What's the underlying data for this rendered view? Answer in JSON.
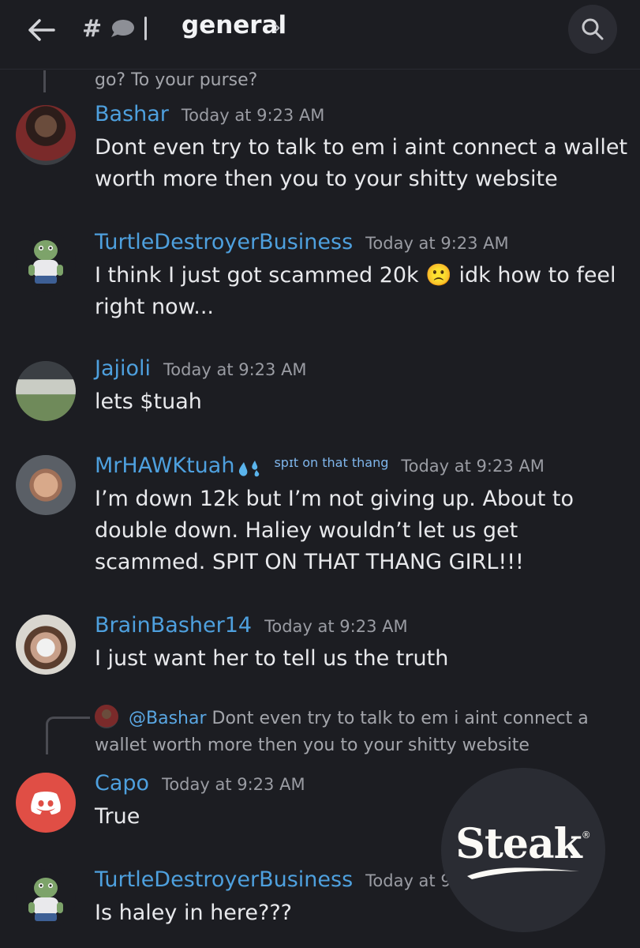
{
  "header": {
    "channel_name": "general",
    "hash_glyph": "#",
    "chevron": "›"
  },
  "previous": {
    "text": "go? To your purse?"
  },
  "messages": [
    {
      "username": "Bashar",
      "timestamp": "Today at 9:23 AM",
      "text": "Dont even try to talk to em i aint connect a wallet worth more then you to your shitty website",
      "avatar": "photo-avatar"
    },
    {
      "username": "TurtleDestroyerBusiness",
      "timestamp": "Today at 9:23 AM",
      "text_before_emoji": "I think I just got scammed 20k ",
      "emoji": "🙁",
      "text_after_emoji": " idk how to feel right now...",
      "avatar": "turtle-avatar"
    },
    {
      "username": "Jajioli",
      "timestamp": "Today at 9:23 AM",
      "text": "lets $tuah",
      "avatar": "landscape-avatar"
    },
    {
      "username": "MrHAWKtuah",
      "role_tag": "spɪt on that thang",
      "timestamp": "Today at 9:23 AM",
      "text": "I’m down 12k but I’m not giving up. About to double down. Haliey wouldn’t let us get scammed. SPIT ON THAT THANG GIRL!!!",
      "avatar": "photo-avatar"
    },
    {
      "username": "BrainBasher14",
      "timestamp": "Today at 9:23 AM",
      "text": "I just want her to tell us the truth",
      "avatar": "photo-avatar"
    },
    {
      "reply_to_user": "@Bashar",
      "reply_preview": "Dont even try to talk to em i aint connect a wallet worth more then you to your shitty website",
      "username": "Capo",
      "timestamp": "Today at 9:23 AM",
      "text": "True",
      "avatar": "discord-logo-avatar"
    },
    {
      "username": "TurtleDestroyerBusiness",
      "timestamp": "Today at 9:",
      "text": "Is haley in here???",
      "avatar": "turtle-avatar"
    }
  ],
  "watermark": {
    "text": "Steak",
    "mark": "®"
  },
  "colors": {
    "background": "#1c1d22",
    "username": "#4ea0de",
    "timestamp": "#9a9ca3",
    "message_text": "#e8e9ec",
    "discord_red": "#e04e45"
  },
  "icons": [
    "back-arrow-icon",
    "channel-hash-icon",
    "chat-bubble-icon",
    "chevron-right-icon",
    "search-icon",
    "discord-logo-icon",
    "sweat-drops-icon",
    "frown-emoji-icon"
  ]
}
